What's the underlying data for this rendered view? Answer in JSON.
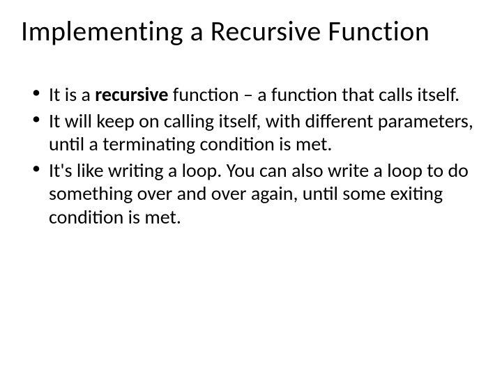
{
  "title": "Implementing a Recursive Function",
  "bullets": [
    {
      "pre": "It is a ",
      "bold": "recursive",
      "post": " function – a function that calls itself."
    },
    {
      "pre": "It will keep on calling itself, with different parameters, until a terminating condition is met.",
      "bold": "",
      "post": ""
    },
    {
      "pre": "It's like writing a loop. You can also write a loop to do something over and over again, until some exiting condition is met.",
      "bold": "",
      "post": ""
    }
  ]
}
